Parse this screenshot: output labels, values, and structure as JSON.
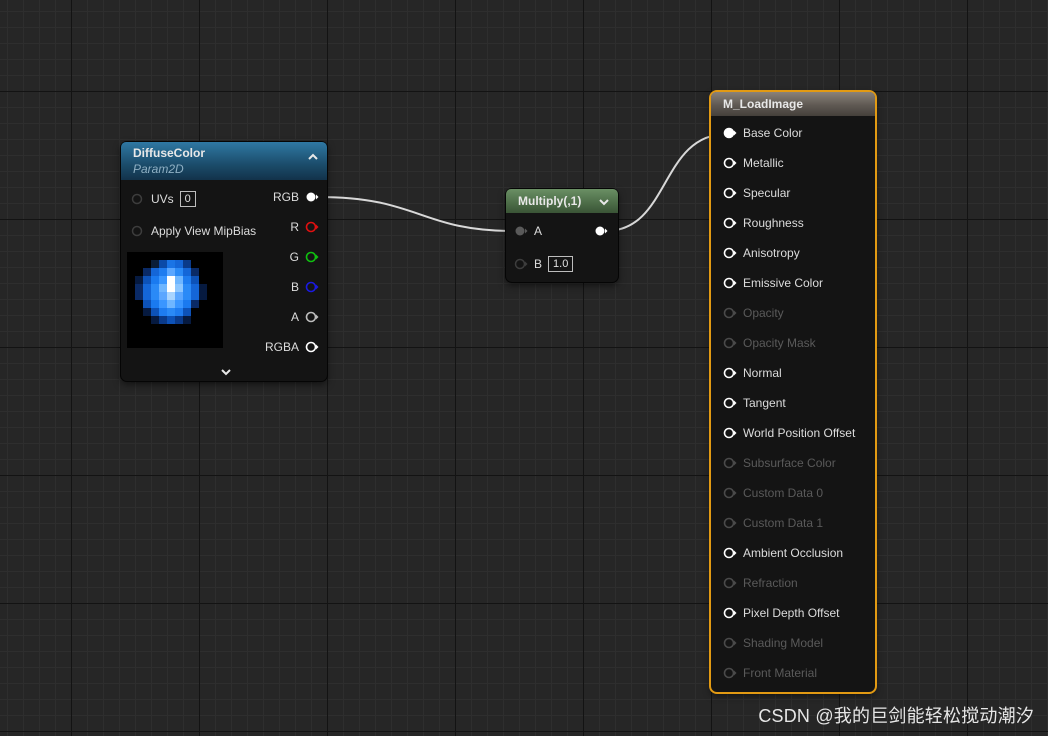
{
  "nodes": {
    "diffuse": {
      "title": "DiffuseColor",
      "subtitle": "Param2D",
      "inputs": [
        {
          "label": "UVs",
          "value": "0"
        },
        {
          "label": "Apply View MipBias"
        }
      ],
      "outputs": [
        {
          "label": "RGB",
          "color": "#ffffff"
        },
        {
          "label": "R",
          "color": "#e01010"
        },
        {
          "label": "G",
          "color": "#10c010"
        },
        {
          "label": "B",
          "color": "#1a1ae0"
        },
        {
          "label": "A",
          "color": "#bdbdbd"
        },
        {
          "label": "RGBA",
          "color": "#ffffff"
        }
      ]
    },
    "multiply": {
      "title": "Multiply(,1)",
      "inputs": [
        {
          "label": "A"
        },
        {
          "label": "B",
          "value": "1.0"
        }
      ]
    },
    "material": {
      "title": "M_LoadImage",
      "inputs": [
        {
          "label": "Base Color",
          "enabled": true,
          "connected": true
        },
        {
          "label": "Metallic",
          "enabled": true
        },
        {
          "label": "Specular",
          "enabled": true
        },
        {
          "label": "Roughness",
          "enabled": true
        },
        {
          "label": "Anisotropy",
          "enabled": true
        },
        {
          "label": "Emissive Color",
          "enabled": true
        },
        {
          "label": "Opacity",
          "enabled": false
        },
        {
          "label": "Opacity Mask",
          "enabled": false
        },
        {
          "label": "Normal",
          "enabled": true
        },
        {
          "label": "Tangent",
          "enabled": true
        },
        {
          "label": "World Position Offset",
          "enabled": true
        },
        {
          "label": "Subsurface Color",
          "enabled": false
        },
        {
          "label": "Custom Data 0",
          "enabled": false
        },
        {
          "label": "Custom Data 1",
          "enabled": false
        },
        {
          "label": "Ambient Occlusion",
          "enabled": true
        },
        {
          "label": "Refraction",
          "enabled": false
        },
        {
          "label": "Pixel Depth Offset",
          "enabled": true
        },
        {
          "label": "Shading Model",
          "enabled": false
        },
        {
          "label": "Front Material",
          "enabled": false
        }
      ]
    }
  },
  "watermark": "CSDN @我的巨剑能轻松搅动潮汐"
}
